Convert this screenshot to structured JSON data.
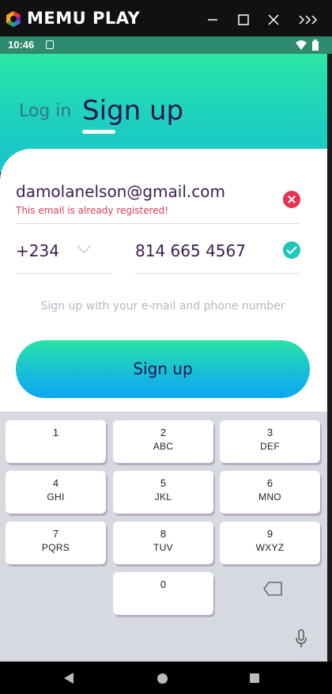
{
  "emulator": {
    "title": "MEMU PLAY",
    "icons": [
      "memu-logo-icon",
      "link-icon",
      "minimize-icon",
      "maximize-icon",
      "close-icon",
      "more-icon"
    ]
  },
  "status_bar": {
    "time": "10:46"
  },
  "tabs": {
    "login": "Log in",
    "signup": "Sign up",
    "active": "signup"
  },
  "form": {
    "email_value": "damolanelson@gmail.com",
    "email_error": "This email is already registered!",
    "country_code": "+234",
    "phone_value": "814 665 4567",
    "hint": "Sign up with your e-mail and phone number",
    "submit_label": "Sign up"
  },
  "keyboard": {
    "keys": [
      {
        "num": "1",
        "letters": ""
      },
      {
        "num": "2",
        "letters": "ABC"
      },
      {
        "num": "3",
        "letters": "DEF"
      },
      {
        "num": "4",
        "letters": "GHI"
      },
      {
        "num": "5",
        "letters": "JKL"
      },
      {
        "num": "6",
        "letters": "MNO"
      },
      {
        "num": "7",
        "letters": "PQRS"
      },
      {
        "num": "8",
        "letters": "TUV"
      },
      {
        "num": "9",
        "letters": "WXYZ"
      },
      {
        "num": "0",
        "letters": ""
      }
    ]
  },
  "colors": {
    "accent_gradient_top": "#2be6a5",
    "accent_gradient_bottom": "#0aa8f0",
    "error": "#e53b57",
    "valid": "#1fc7b8",
    "text_dark": "#2a1652"
  }
}
